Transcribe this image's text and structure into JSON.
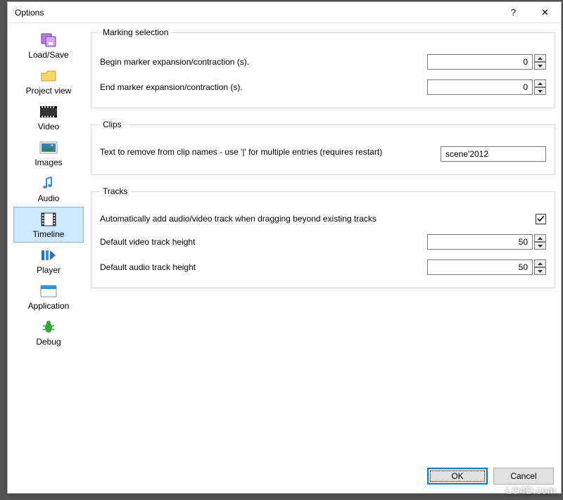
{
  "window": {
    "title": "Options",
    "help_glyph": "?",
    "close_glyph": "✕"
  },
  "sidebar": {
    "items": [
      {
        "label": "Load/Save",
        "icon": "loadsave-icon"
      },
      {
        "label": "Project view",
        "icon": "projectview-icon"
      },
      {
        "label": "Video",
        "icon": "video-icon"
      },
      {
        "label": "Images",
        "icon": "images-icon"
      },
      {
        "label": "Audio",
        "icon": "audio-icon"
      },
      {
        "label": "Timeline",
        "icon": "timeline-icon"
      },
      {
        "label": "Player",
        "icon": "player-icon"
      },
      {
        "label": "Application",
        "icon": "application-icon"
      },
      {
        "label": "Debug",
        "icon": "debug-icon"
      }
    ],
    "selected_index": 5
  },
  "groups": {
    "marking": {
      "legend": "Marking selection",
      "begin_label": "Begin marker expansion/contraction (s).",
      "begin_value": "0",
      "end_label": "End marker expansion/contraction (s).",
      "end_value": "0"
    },
    "clips": {
      "legend": "Clips",
      "text_remove_label": "Text to remove from clip names - use '|' for multiple entries (requires restart)",
      "text_remove_value": "scene'2012"
    },
    "tracks": {
      "legend": "Tracks",
      "auto_add_label": "Automatically add audio/video track when dragging beyond existing tracks",
      "auto_add_checked": true,
      "video_height_label": "Default video track height",
      "video_height_value": "50",
      "audio_height_label": "Default audio track height",
      "audio_height_value": "50"
    }
  },
  "buttons": {
    "ok": "OK",
    "cancel": "Cancel"
  },
  "watermark": "LO4D.com"
}
